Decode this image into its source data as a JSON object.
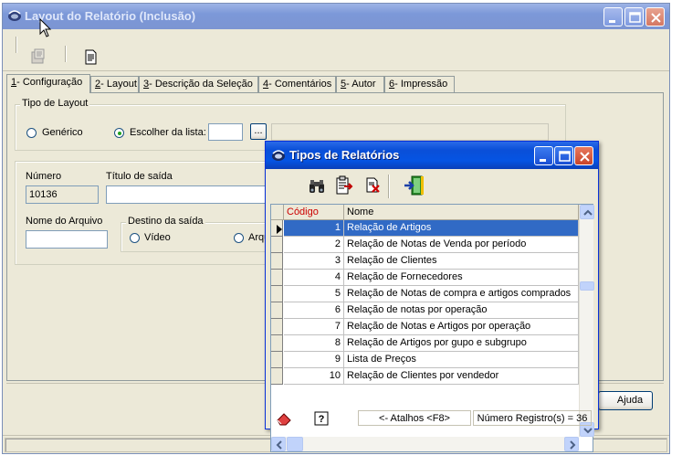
{
  "window": {
    "title": "Layout do Relatório (Inclusão)"
  },
  "tabs": [
    {
      "key": "1",
      "rest": "- Configuração"
    },
    {
      "key": "2",
      "rest": "- Layout"
    },
    {
      "key": "3",
      "rest": "- Descrição da Seleção"
    },
    {
      "key": "4",
      "rest": "- Comentários"
    },
    {
      "key": "5",
      "rest": "- Autor"
    },
    {
      "key": "6",
      "rest": "- Impressão"
    }
  ],
  "tipo_layout": {
    "legend": "Tipo de Layout",
    "generico": "Genérico",
    "escolher": "Escolher da lista:",
    "browse": "...",
    "selected": "escolher"
  },
  "fields": {
    "numero_label": "Número",
    "numero_value": "10136",
    "titulo_label": "Título de saída",
    "titulo_value": "",
    "nome_arquivo_label": "Nome do Arquivo",
    "nome_arquivo_value": ""
  },
  "destino": {
    "legend": "Destino da saída",
    "video": "Vídeo",
    "arquivo_partial": "Arqu"
  },
  "footer": {
    "ajuda": "Ajuda"
  },
  "dialog": {
    "title": "Tipos de Relatórios",
    "columns": {
      "codigo": "Código",
      "nome": "Nome"
    },
    "rows": [
      {
        "codigo": "1",
        "nome": "Relação de Artigos"
      },
      {
        "codigo": "2",
        "nome": "Relação de Notas de Venda por período"
      },
      {
        "codigo": "3",
        "nome": "Relação de Clientes"
      },
      {
        "codigo": "4",
        "nome": "Relação de Fornecedores"
      },
      {
        "codigo": "5",
        "nome": "Relação de Notas de compra e artigos comprados"
      },
      {
        "codigo": "6",
        "nome": "Relação de notas por operação"
      },
      {
        "codigo": "7",
        "nome": "Relação de Notas e Artigos por operação"
      },
      {
        "codigo": "8",
        "nome": "Relação de Artigos por gupo e subgrupo"
      },
      {
        "codigo": "9",
        "nome": "Lista de Preços"
      },
      {
        "codigo": "10",
        "nome": "Relação de Clientes por vendedor"
      }
    ],
    "selected_row": 0,
    "status": {
      "atalhos": "<- Atalhos <F8>",
      "registros": "Número Registro(s) = 36"
    }
  },
  "colors": {
    "selection": "#316ac5",
    "codigo_header": "#cc0000",
    "title_active": "#0554e3",
    "title_inactive": "#7c98d8"
  }
}
